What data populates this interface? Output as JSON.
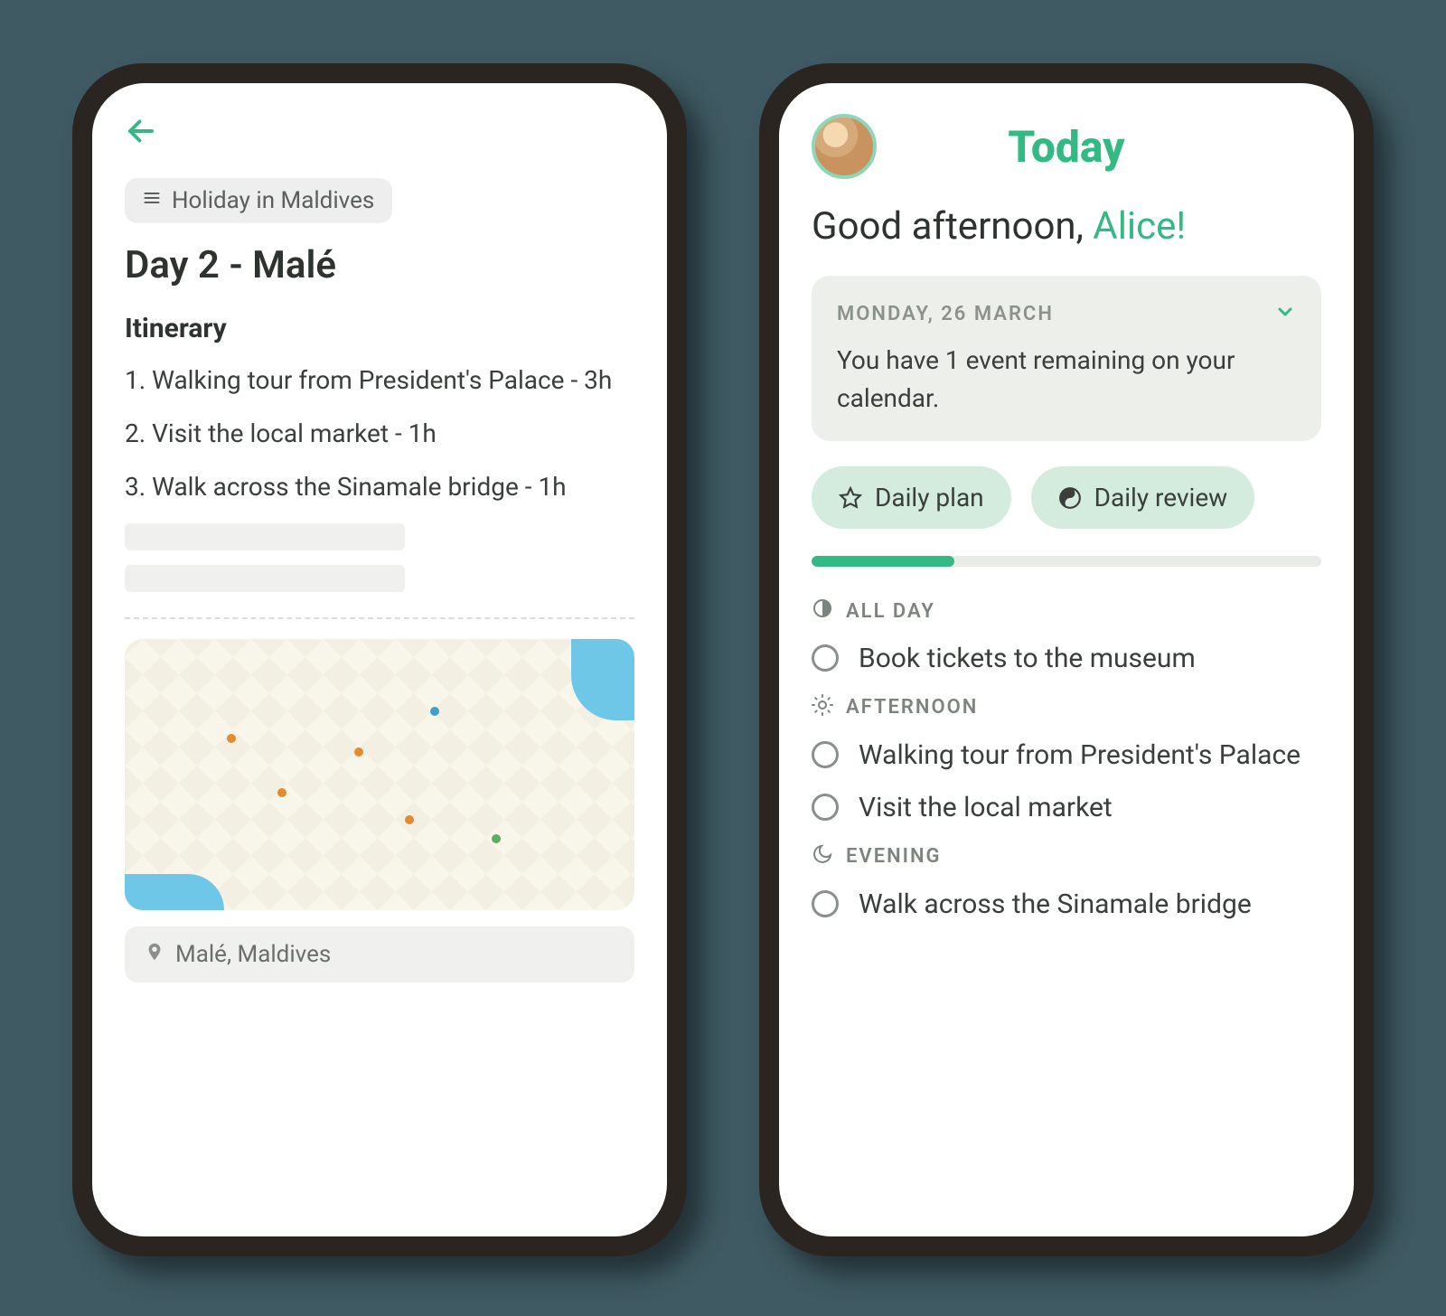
{
  "left": {
    "breadcrumb": "Holiday in Maldives",
    "title": "Day 2 - Malé",
    "section": "Itinerary",
    "items": [
      "1. Walking tour from President's Palace - 3h",
      "2. Visit the local market - 1h",
      "3. Walk across the Sinamale bridge - 1h"
    ],
    "location": "Malé, Maldives"
  },
  "right": {
    "header_title": "Today",
    "greeting_prefix": "Good afternoon, ",
    "greeting_name": "Alice!",
    "card": {
      "date": "MONDAY, 26 MARCH",
      "body": "You have 1 event remaining on your calendar."
    },
    "pills": {
      "plan": "Daily plan",
      "review": "Daily review"
    },
    "progress_percent": 28,
    "groups": [
      {
        "label": "ALL DAY",
        "icon": "contrast-icon",
        "tasks": [
          "Book tickets to the museum"
        ]
      },
      {
        "label": "AFTERNOON",
        "icon": "sun-icon",
        "tasks": [
          "Walking tour from President's Palace",
          "Visit the local market"
        ]
      },
      {
        "label": "EVENING",
        "icon": "moon-icon",
        "tasks": [
          "Walk across the Sinamale bridge"
        ]
      }
    ]
  },
  "colors": {
    "accent": "#33b983"
  }
}
